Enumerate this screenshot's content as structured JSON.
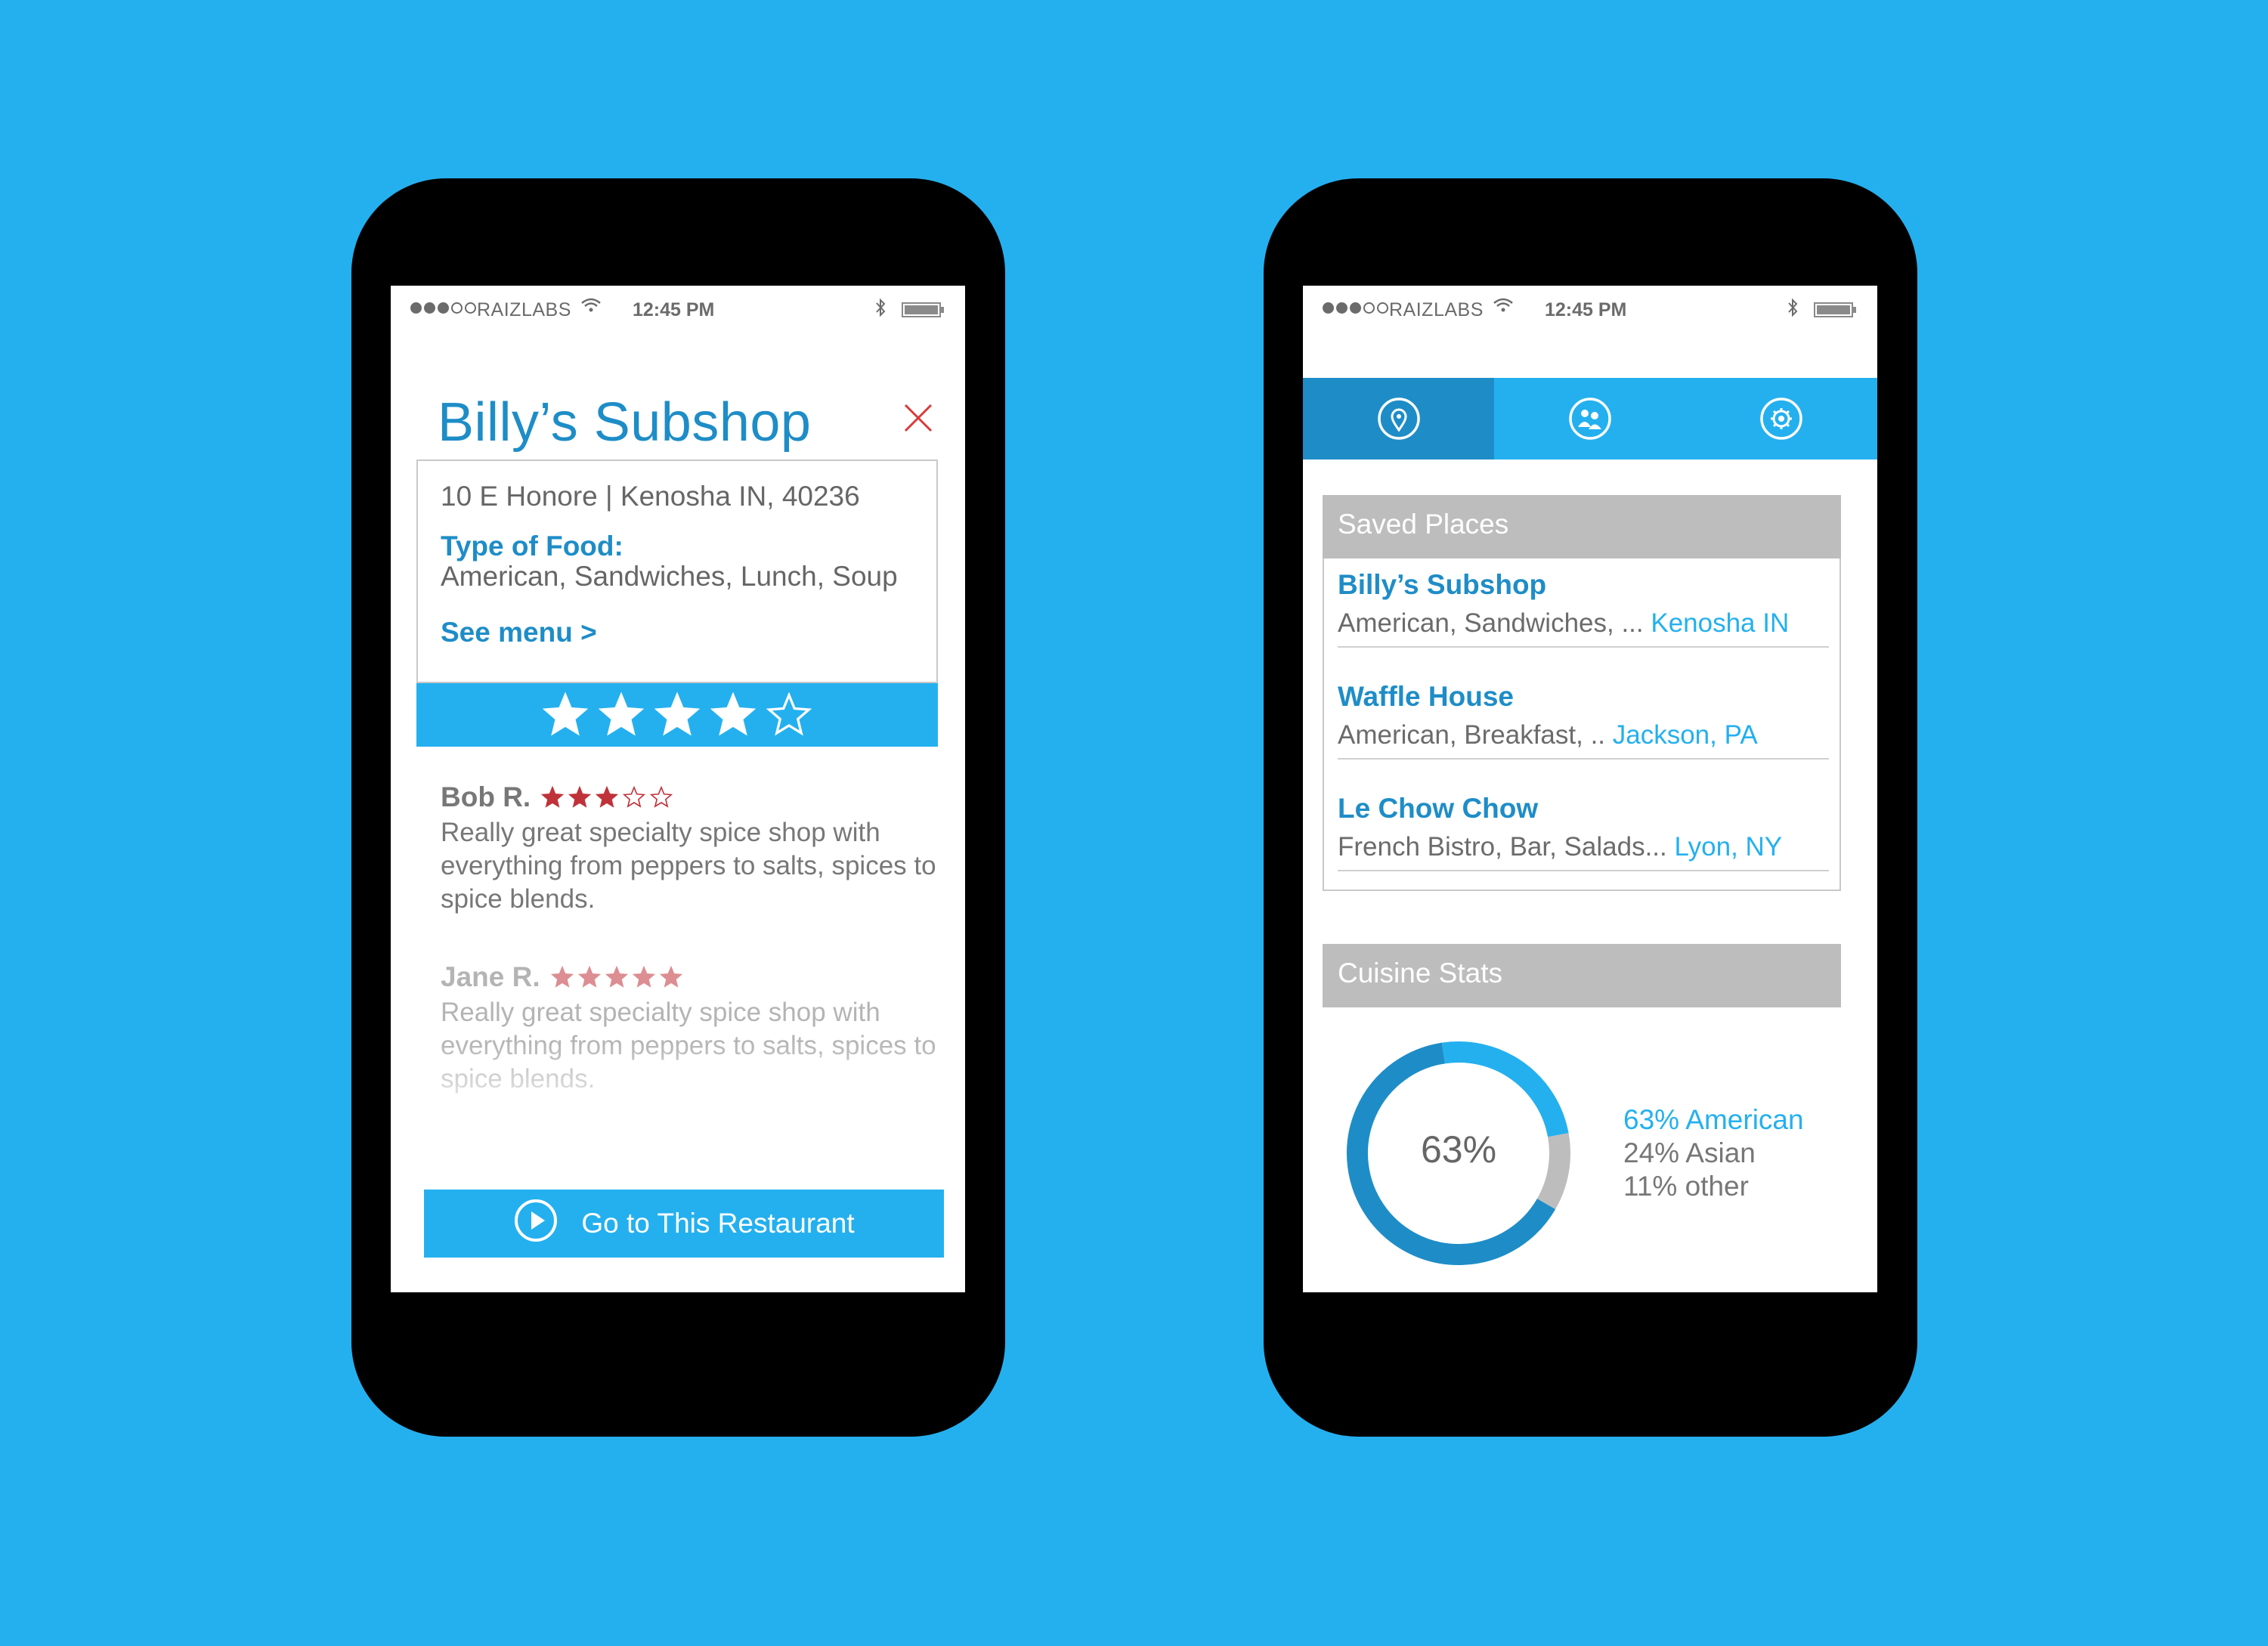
{
  "status_bar": {
    "carrier": "RAIZLABS",
    "time": "12:45 PM"
  },
  "detail_screen": {
    "title": "Billy’s Subshop",
    "address": "10 E Honore | Kenosha IN, 40236",
    "type_of_food_label": "Type of Food:",
    "type_of_food_value": "American, Sandwiches, Lunch, Soup",
    "see_menu_label": "See menu >",
    "rating": {
      "value": 4,
      "max": 5
    },
    "reviews": [
      {
        "name": "Bob R.",
        "rating": 3,
        "text": "Really great specialty spice shop with everything from peppers to salts, spices to spice blends."
      },
      {
        "name": "Jane R.",
        "rating": 5,
        "text": "Really great specialty spice shop with everything from peppers to salts, spices to spice blends."
      }
    ],
    "go_button_label": "Go to This Restaurant"
  },
  "profile_screen": {
    "tabs": [
      {
        "icon": "location-pin-icon",
        "active": true
      },
      {
        "icon": "people-icon",
        "active": false
      },
      {
        "icon": "gear-icon",
        "active": false
      }
    ],
    "saved_places_header": "Saved Places",
    "saved_places": [
      {
        "name": "Billy’s Subshop",
        "description": "American, Sandwiches, ... ",
        "location": "Kenosha IN"
      },
      {
        "name": "Waffle House",
        "description": "American, Breakfast, .. ",
        "location": "Jackson, PA"
      },
      {
        "name": "Le Chow Chow",
        "description": "French Bistro, Bar, Salads... ",
        "location": "Lyon, NY"
      }
    ],
    "cuisine_stats_header": "Cuisine Stats",
    "donut_center_label": "63%",
    "legend": [
      {
        "label": "63% American"
      },
      {
        "label": "24% Asian"
      },
      {
        "label": "11% other"
      }
    ]
  },
  "chart_data": {
    "type": "pie",
    "categories": [
      "American",
      "Asian",
      "other"
    ],
    "values": [
      63,
      24,
      11
    ]
  },
  "colors": {
    "background": "#24b0ef",
    "accent": "#1e8dc7",
    "accent_light": "#24b0ef",
    "grey_header": "#bdbdbd",
    "star_red": "#c0323a",
    "close_red": "#d93a3a",
    "donut_grey": "#bdbdbd"
  }
}
